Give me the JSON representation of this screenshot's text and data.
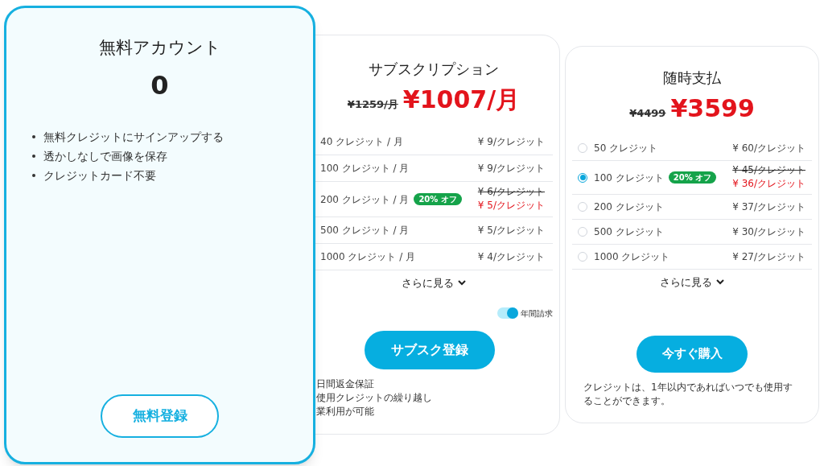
{
  "free": {
    "title": "無料アカウント",
    "price": "0",
    "features": [
      "無料クレジットにサインアップする",
      "透かしなしで画像を保存",
      "クレジットカード不要"
    ],
    "button": "無料登録"
  },
  "subscription": {
    "title": "サブスクリプション",
    "old_price": "¥1259/月",
    "price": "¥1007/月",
    "plans": [
      {
        "credits": "40 クレジット / 月",
        "price": "¥ 9/クレジット"
      },
      {
        "credits": "100 クレジット / 月",
        "price": "¥ 9/クレジット"
      },
      {
        "credits": "200 クレジット / 月",
        "badge": "20% オフ",
        "old_price": "¥ 6/クレジット",
        "price": "¥ 5/クレジット"
      },
      {
        "credits": "500 クレジット / 月",
        "price": "¥ 5/クレジット"
      },
      {
        "credits": "1000 クレジット / 月",
        "price": "¥ 4/クレジット"
      }
    ],
    "more": "さらに見る",
    "toggle": {
      "label": "年間請求",
      "on": true
    },
    "button": "サブスク登録",
    "features": [
      "日間返金保証",
      "使用クレジットの繰り越し",
      "業利用が可能"
    ]
  },
  "payg": {
    "title": "随時支払",
    "old_price": "¥4499",
    "price": "¥3599",
    "plans": [
      {
        "credits": "50 クレジット",
        "selected": false,
        "price": "¥ 60/クレジット"
      },
      {
        "credits": "100 クレジット",
        "selected": true,
        "badge": "20% オフ",
        "old_price": "¥ 45/クレジット",
        "price": "¥ 36/クレジット"
      },
      {
        "credits": "200 クレジット",
        "selected": false,
        "price": "¥ 37/クレジット"
      },
      {
        "credits": "500 クレジット",
        "selected": false,
        "price": "¥ 30/クレジット"
      },
      {
        "credits": "1000 クレジット",
        "selected": false,
        "price": "¥ 27/クレジット"
      }
    ],
    "more": "さらに見る",
    "button": "今すぐ購入",
    "note": "クレジットは、1年以内であればいつでも使用することができます。"
  }
}
